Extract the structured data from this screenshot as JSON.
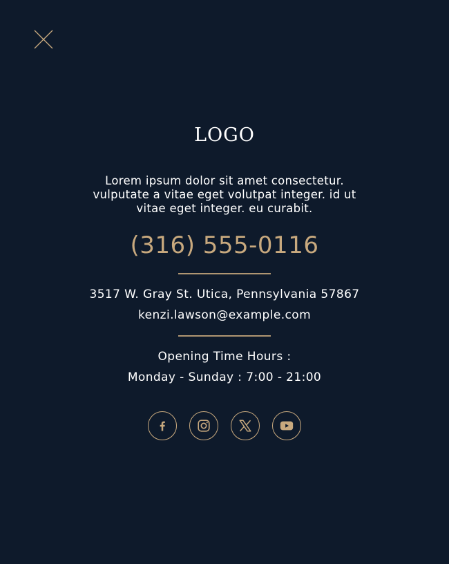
{
  "header": {
    "close_icon": "close-icon"
  },
  "logo": {
    "text": "LOGO"
  },
  "description": "Lorem ipsum dolor sit amet consectetur. vulputate a vitae eget volutpat integer. id ut vitae eget integer. eu curabit.",
  "contact": {
    "phone": "(316) 555-0116",
    "address": "3517 W. Gray St. Utica, Pennsylvania 57867",
    "email": "kenzi.lawson@example.com"
  },
  "hours": {
    "title": "Opening Time Hours :",
    "value": "Monday - Sunday : 7:00 - 21:00"
  },
  "social": [
    {
      "icon": "facebook-icon"
    },
    {
      "icon": "instagram-icon"
    },
    {
      "icon": "x-icon"
    },
    {
      "icon": "youtube-icon"
    }
  ],
  "colors": {
    "background": "#0e1a2b",
    "accent": "#c8a97e",
    "text": "#ffffff"
  }
}
